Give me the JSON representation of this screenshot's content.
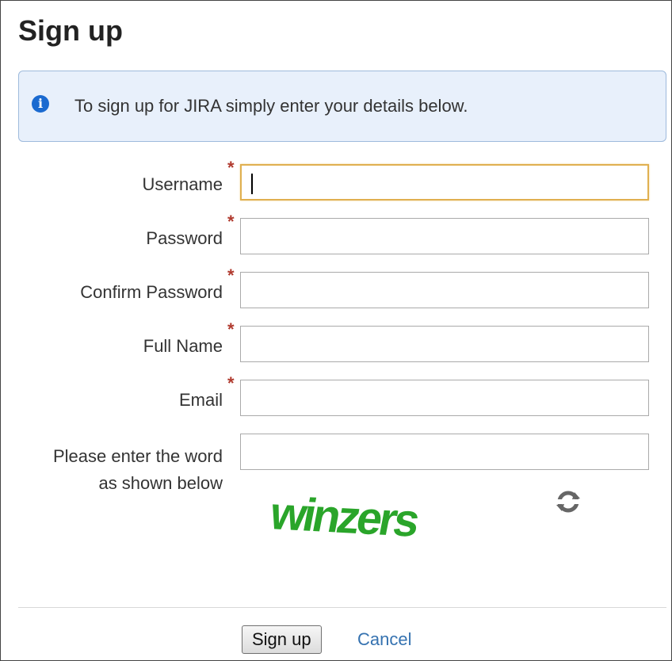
{
  "dialog": {
    "title": "Sign up"
  },
  "info": {
    "icon": "info-icon",
    "text": "To sign up for JIRA simply enter your details below.",
    "background_color": "#e8f0fb",
    "icon_color": "#1a6ad0"
  },
  "form": {
    "required_marker": "*",
    "fields": {
      "username": {
        "label": "Username",
        "value": "",
        "required": true,
        "focused": true
      },
      "password": {
        "label": "Password",
        "value": "",
        "required": true
      },
      "confirm_password": {
        "label": "Confirm Password",
        "value": "",
        "required": true
      },
      "full_name": {
        "label": "Full Name",
        "value": "",
        "required": true
      },
      "email": {
        "label": "Email",
        "value": "",
        "required": true
      }
    },
    "captcha": {
      "label_line1": "Please enter the word",
      "label_line2": "as shown below",
      "value": "",
      "word": "winzers",
      "word_color": "#2aa52a",
      "refresh_icon": "refresh-icon"
    }
  },
  "footer": {
    "submit_label": "Sign up",
    "cancel_label": "Cancel",
    "link_color": "#3572b0"
  }
}
